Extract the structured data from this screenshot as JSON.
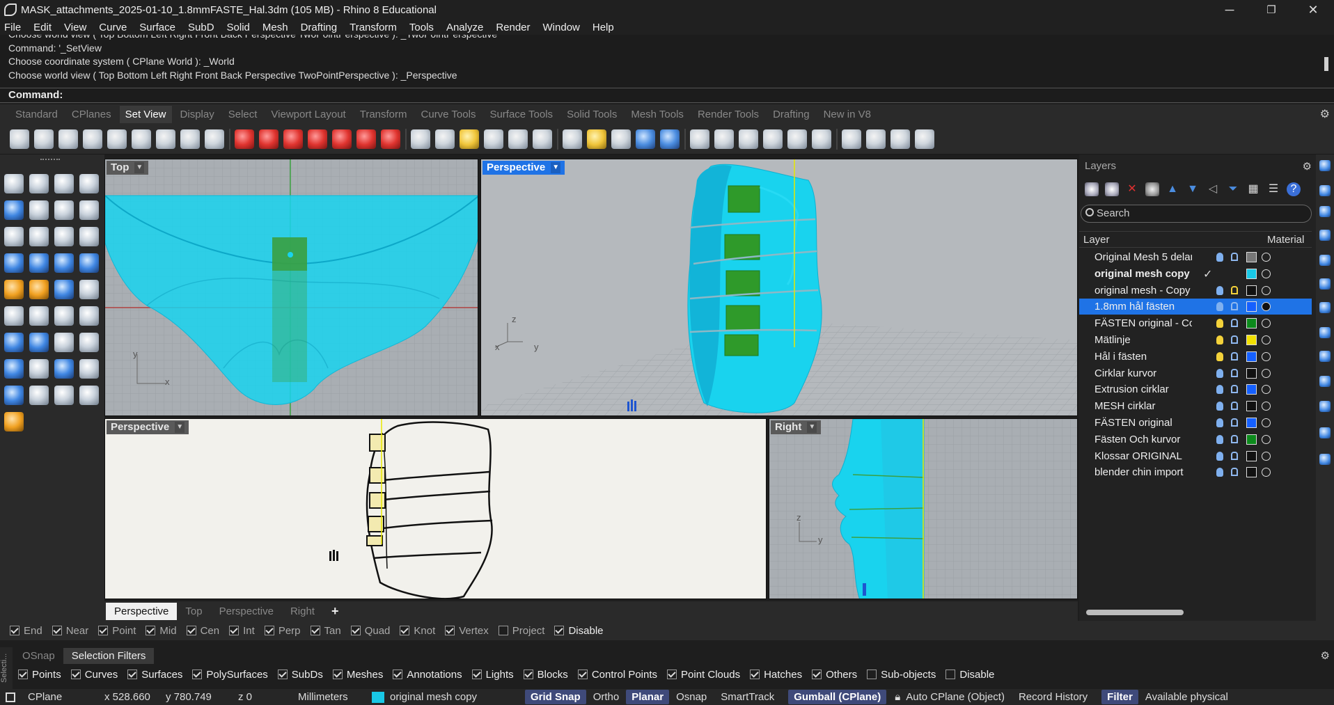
{
  "window": {
    "title": "MASK_attachments_2025-01-10_1.8mmFASTE_Hal.3dm (105 MB) - Rhino 8 Educational",
    "minimize": "─",
    "maximize": "❐",
    "close": "✕"
  },
  "menu": [
    "File",
    "Edit",
    "View",
    "Curve",
    "Surface",
    "SubD",
    "Solid",
    "Mesh",
    "Drafting",
    "Transform",
    "Tools",
    "Analyze",
    "Render",
    "Window",
    "Help"
  ],
  "command_history": [
    "Choose world view ( Top  Bottom  Left  Right  Front  Back  Perspective  TwoPointPerspective ): _TwoPointPerspective",
    "Command: '_SetView",
    "Choose coordinate system ( CPlane  World ): _World",
    "Choose world view ( Top  Bottom  Left  Right  Front  Back  Perspective  TwoPointPerspective ): _Perspective"
  ],
  "command_prompt": "Command:",
  "toolbar_tabs": [
    "Standard",
    "CPlanes",
    "Set View",
    "Display",
    "Select",
    "Viewport Layout",
    "Transform",
    "Curve Tools",
    "Surface Tools",
    "Solid Tools",
    "Mesh Tools",
    "Render Tools",
    "Drafting",
    "New in V8"
  ],
  "active_toolbar_tab": "Set View",
  "viewports": {
    "top": {
      "label": "Top",
      "axis_x": "x",
      "axis_y": "y"
    },
    "perspective": {
      "label": "Perspective",
      "axis_x": "x",
      "axis_y": "y",
      "axis_z": "z"
    },
    "perspective2": {
      "label": "Perspective"
    },
    "right": {
      "label": "Right",
      "axis_y": "y",
      "axis_z": "z"
    }
  },
  "viewport_tabs": [
    "Perspective",
    "Top",
    "Perspective",
    "Right"
  ],
  "viewport_tab_add": "+",
  "layers": {
    "title": "Layers",
    "search_placeholder": "Search",
    "col_layer": "Layer",
    "col_material": "Material",
    "rows": [
      {
        "name": "Original Mesh 5 delar",
        "color": "#777777",
        "bulb": "off",
        "lock": "closed"
      },
      {
        "name": "original mesh copy",
        "color": "#19c8e6",
        "current": true
      },
      {
        "name": "original mesh - Copy",
        "color": "#111111",
        "bulb": "off",
        "lock": "open"
      },
      {
        "name": "1.8mm hål fästen",
        "color": "#1560ff",
        "selected": true
      },
      {
        "name": "FÄSTEN original - Copy",
        "color": "#0c8a1c",
        "bulb": "on"
      },
      {
        "name": "Mätlinje",
        "color": "#f2e000",
        "bulb": "on"
      },
      {
        "name": "Hål i fästen",
        "color": "#1560ff",
        "bulb": "on"
      },
      {
        "name": "Cirklar kurvor",
        "color": "#111111"
      },
      {
        "name": "Extrusion cirklar",
        "color": "#1560ff"
      },
      {
        "name": "MESH cirklar",
        "color": "#111111"
      },
      {
        "name": "FÄSTEN original",
        "color": "#1560ff"
      },
      {
        "name": "Fästen Och kurvor",
        "color": "#0c8a1c"
      },
      {
        "name": "Klossar ORIGINAL",
        "color": "#111111"
      },
      {
        "name": "blender chin import",
        "color": "#111111"
      }
    ]
  },
  "osnap": {
    "items": [
      {
        "label": "End",
        "checked": true
      },
      {
        "label": "Near",
        "checked": true
      },
      {
        "label": "Point",
        "checked": true
      },
      {
        "label": "Mid",
        "checked": true
      },
      {
        "label": "Cen",
        "checked": true
      },
      {
        "label": "Int",
        "checked": true
      },
      {
        "label": "Perp",
        "checked": true
      },
      {
        "label": "Tan",
        "checked": true
      },
      {
        "label": "Quad",
        "checked": true
      },
      {
        "label": "Knot",
        "checked": true
      },
      {
        "label": "Vertex",
        "checked": true
      },
      {
        "label": "Project",
        "checked": false
      },
      {
        "label": "Disable",
        "checked": true
      }
    ]
  },
  "panel_tabs": [
    "OSnap",
    "Selection Filters"
  ],
  "active_panel_tab": "Selection Filters",
  "side_label": "Selecti...",
  "selection_filters": [
    {
      "label": "Points",
      "checked": true
    },
    {
      "label": "Curves",
      "checked": true
    },
    {
      "label": "Surfaces",
      "checked": true
    },
    {
      "label": "PolySurfaces",
      "checked": true
    },
    {
      "label": "SubDs",
      "checked": true
    },
    {
      "label": "Meshes",
      "checked": true
    },
    {
      "label": "Annotations",
      "checked": true
    },
    {
      "label": "Lights",
      "checked": true
    },
    {
      "label": "Blocks",
      "checked": true
    },
    {
      "label": "Control Points",
      "checked": true
    },
    {
      "label": "Point Clouds",
      "checked": true
    },
    {
      "label": "Hatches",
      "checked": true
    },
    {
      "label": "Others",
      "checked": true
    },
    {
      "label": "Sub-objects",
      "checked": false
    },
    {
      "label": "Disable",
      "checked": false
    }
  ],
  "status": {
    "cplane": "CPlane",
    "x": "x 528.660",
    "y": "y 780.749",
    "z": "z 0",
    "units": "Millimeters",
    "layer_color": "#19c8e6",
    "layer": "original mesh copy",
    "grid_snap": "Grid Snap",
    "ortho": "Ortho",
    "planar": "Planar",
    "osnap": "Osnap",
    "smarttrack": "SmartTrack",
    "gumball": "Gumball (CPlane)",
    "auto_cplane": "Auto CPlane (Object)",
    "record_history": "Record History",
    "filter": "Filter",
    "available": "Available physical"
  }
}
